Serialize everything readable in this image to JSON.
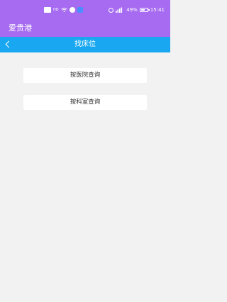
{
  "status_bar": {
    "battery": "49%",
    "time": "15:41",
    "colors": {
      "background": "#a66bf0",
      "icon": "#ffffff"
    },
    "icons": [
      "message-icon",
      "hd-icon",
      "wifi-icon",
      "circle-icon",
      "app-icon",
      "alarm-icon",
      "signal-icon",
      "battery-icon"
    ]
  },
  "app_bar": {
    "title": "爱贵港",
    "color": "#a66bf0"
  },
  "nav_bar": {
    "title": "找床位",
    "back_icon": "chevron-left-icon",
    "color": "#18a7f0"
  },
  "main": {
    "options": [
      {
        "label": "按医院查询"
      },
      {
        "label": "按科室查询"
      }
    ],
    "background": "#f2f2f2"
  }
}
